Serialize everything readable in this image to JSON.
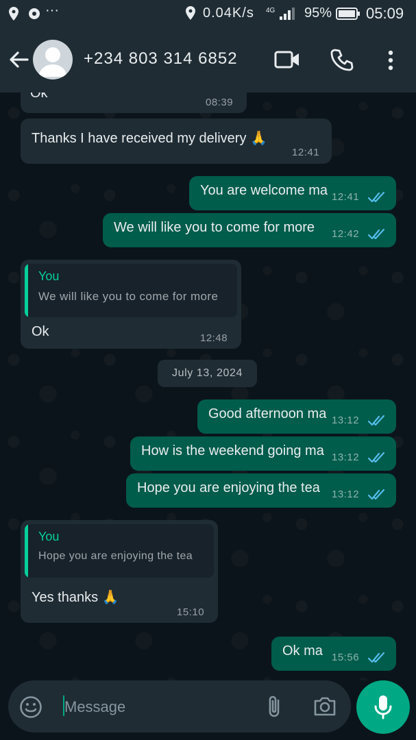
{
  "status_bar": {
    "net_speed": "0.04K/s",
    "network": "4G",
    "battery": "95%",
    "time": "05:09",
    "more": "···"
  },
  "header": {
    "contact": "+234 803 314 6852",
    "icons": [
      "back-arrow-icon",
      "avatar",
      "video-call-icon",
      "phone-icon",
      "more-vert-icon"
    ]
  },
  "messages": [
    {
      "dir": "in",
      "text": "Ok",
      "time": "08:39"
    },
    {
      "dir": "in",
      "text": "Thanks I have received my delivery 🙏",
      "time": "12:41"
    },
    {
      "dir": "out",
      "text": "You are welcome ma",
      "time": "12:41",
      "read": true
    },
    {
      "dir": "out",
      "text": "We will like you to come for more",
      "time": "12:42",
      "read": true
    },
    {
      "dir": "in",
      "quote_name": "You",
      "quote_text": "We will like you to come for more",
      "text": "Ok",
      "time": "12:48"
    },
    {
      "dir": "out",
      "text": "Good afternoon ma",
      "time": "13:12",
      "read": true
    },
    {
      "dir": "out",
      "text": "How is the weekend going ma",
      "time": "13:12",
      "read": true
    },
    {
      "dir": "out",
      "text": "Hope you are enjoying the tea",
      "time": "13:12",
      "read": true
    },
    {
      "dir": "in",
      "quote_name": "You",
      "quote_text": "Hope you are enjoying the tea",
      "text": "Yes thanks 🙏",
      "time": "15:10"
    },
    {
      "dir": "out",
      "text": "Ok ma",
      "time": "15:56",
      "read": true
    }
  ],
  "date_chip": "July 13, 2024",
  "composer": {
    "placeholder": "Message",
    "icons": [
      "emoji-icon",
      "attach-icon",
      "camera-icon",
      "mic-icon"
    ]
  },
  "colors": {
    "background": "#0b141a",
    "incoming_bubble": "#1f2c34",
    "outgoing_bubble": "#005c4b",
    "accent": "#00a884",
    "read_ticks": "#53bdeb"
  }
}
